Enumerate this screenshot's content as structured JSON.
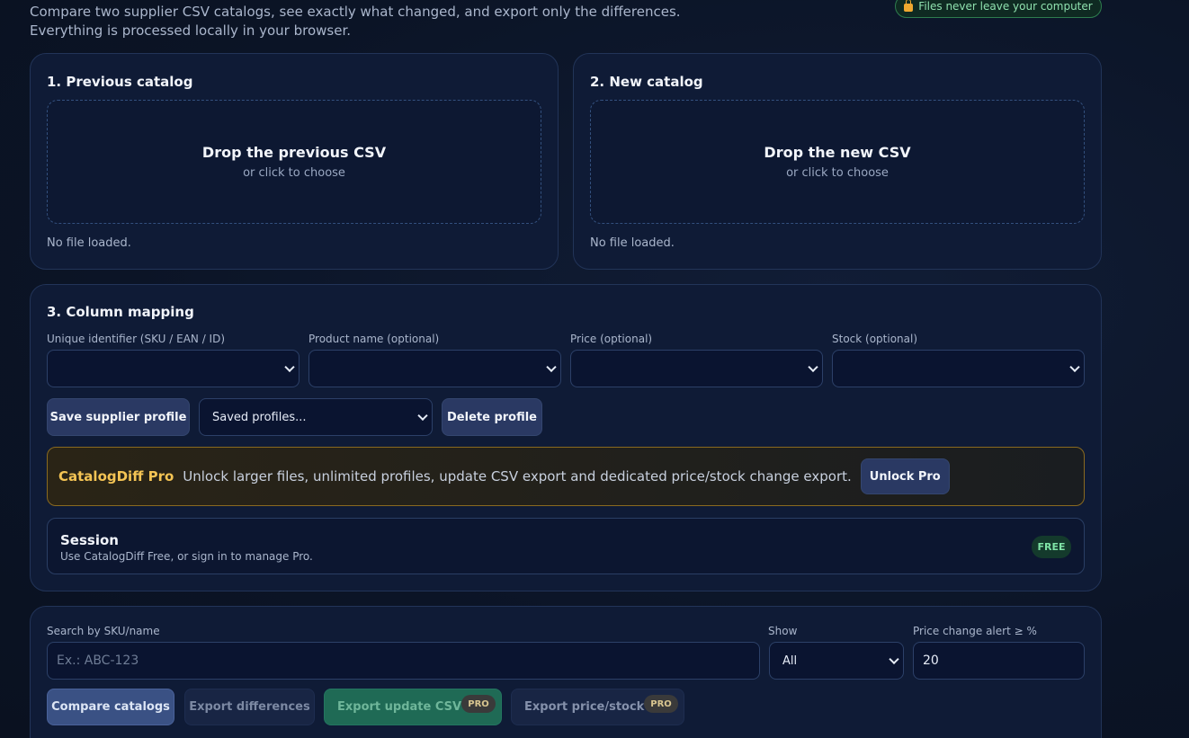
{
  "intro": {
    "text": "Compare two supplier CSV catalogs, see exactly what changed, and export only the differences. Everything is processed locally in your browser."
  },
  "privacy_badge": {
    "text": "Files never leave your computer",
    "icon": "lock-icon"
  },
  "previous": {
    "title": "1. Previous catalog",
    "drop_title": "Drop the previous CSV",
    "drop_sub": "or click to choose",
    "status": "No file loaded."
  },
  "new": {
    "title": "2. New catalog",
    "drop_title": "Drop the new CSV",
    "drop_sub": "or click to choose",
    "status": "No file loaded."
  },
  "mapping": {
    "title": "3. Column mapping",
    "id_label": "Unique identifier (SKU / EAN / ID)",
    "name_label": "Product name (optional)",
    "price_label": "Price (optional)",
    "stock_label": "Stock (optional)",
    "save_profile": "Save supplier profile",
    "saved_profiles": "Saved profiles...",
    "delete_profile": "Delete profile"
  },
  "pro": {
    "brand": "CatalogDiff Pro",
    "text": "Unlock larger files, unlimited profiles, update CSV export and dedicated price/stock change export.",
    "button": "Unlock Pro"
  },
  "session": {
    "title": "Session",
    "sub": "Use CatalogDiff Free, or sign in to manage Pro.",
    "badge": "FREE"
  },
  "filters": {
    "search_label": "Search by SKU/name",
    "search_placeholder": "Ex.: ABC-123",
    "show_label": "Show",
    "show_value": "All",
    "alert_label": "Price change alert ≥ %",
    "alert_value": "20"
  },
  "actions": {
    "compare": "Compare catalogs",
    "export_diff": "Export differences",
    "export_update": "Export update CSV",
    "export_price": "Export price/stock",
    "pro_tag": "PRO"
  },
  "colors": {
    "accent_gold": "#f4c454",
    "free_green": "#7fe3a6",
    "background": "#0b1426"
  }
}
